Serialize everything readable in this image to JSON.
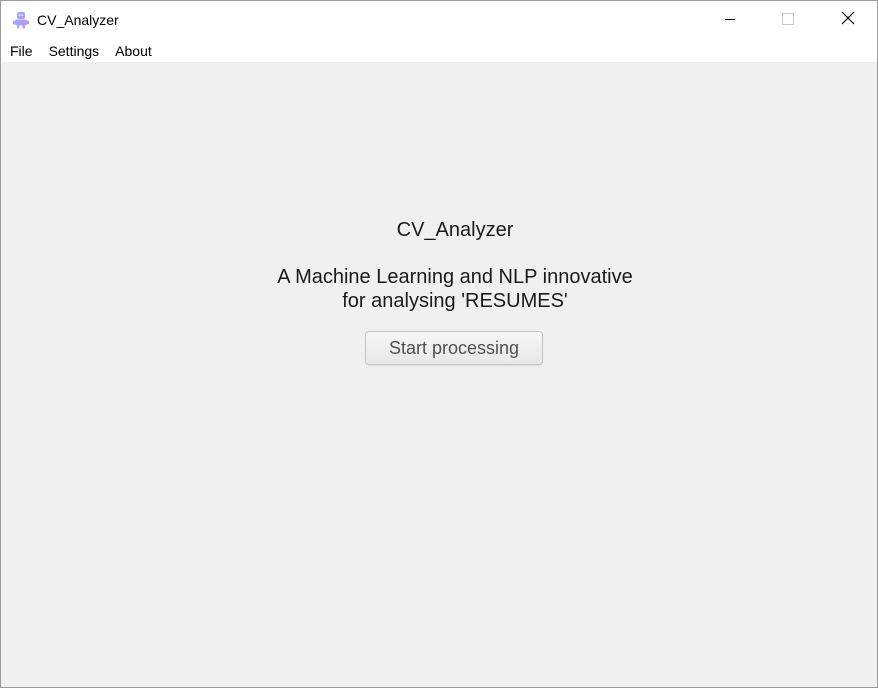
{
  "window": {
    "title": "CV_Analyzer",
    "app_icon": "robot-app-icon",
    "controls": {
      "minimize_icon": "minimize-icon",
      "maximize_icon": "maximize-icon",
      "close_icon": "close-icon"
    }
  },
  "menu": {
    "items": [
      {
        "label": "File"
      },
      {
        "label": "Settings"
      },
      {
        "label": "About"
      }
    ]
  },
  "main": {
    "heading": "CV_Analyzer",
    "subtitle_line1": "A Machine Learning and NLP innovative",
    "subtitle_line2": "for analysing 'RESUMES'",
    "start_button_label": "Start processing"
  },
  "colors": {
    "window_background": "#f0f0f0",
    "titlebar_background": "#ffffff",
    "text": "#1a1a1a",
    "button_text": "#505050"
  }
}
